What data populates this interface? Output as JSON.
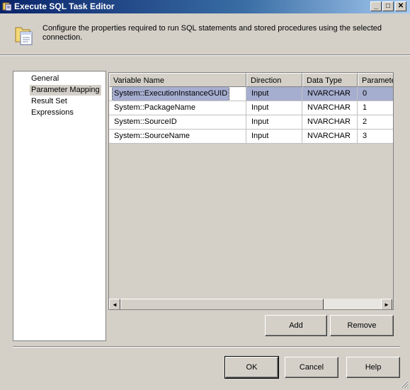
{
  "window": {
    "title": "Execute SQL Task Editor",
    "controls": {
      "minimize": "_",
      "maximize": "□",
      "close": "✕"
    }
  },
  "header": {
    "description": "Configure the properties required to run SQL statements and stored procedures using the selected connection."
  },
  "nav": {
    "items": [
      {
        "label": "General"
      },
      {
        "label": "Parameter Mapping"
      },
      {
        "label": "Result Set"
      },
      {
        "label": "Expressions"
      }
    ],
    "selected_index": 1
  },
  "grid": {
    "columns": [
      "Variable Name",
      "Direction",
      "Data Type",
      "Paramete"
    ],
    "rows": [
      {
        "variable": "System::ExecutionInstanceGUID",
        "direction": "Input",
        "data_type": "NVARCHAR",
        "parameter": "0"
      },
      {
        "variable": "System::PackageName",
        "direction": "Input",
        "data_type": "NVARCHAR",
        "parameter": "1"
      },
      {
        "variable": "System::SourceID",
        "direction": "Input",
        "data_type": "NVARCHAR",
        "parameter": "2"
      },
      {
        "variable": "System::SourceName",
        "direction": "Input",
        "data_type": "NVARCHAR",
        "parameter": "3"
      }
    ],
    "selected_row": 0
  },
  "actions": {
    "add": "Add",
    "remove": "Remove"
  },
  "footer": {
    "ok": "OK",
    "cancel": "Cancel",
    "help": "Help"
  },
  "icons": {
    "title": "ssis-task-icon",
    "header": "folder-document-icon",
    "scroll_left": "◄",
    "scroll_right": "►"
  }
}
